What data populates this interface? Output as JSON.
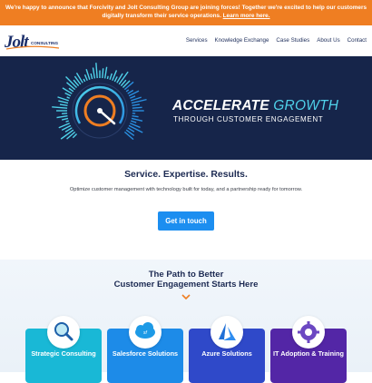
{
  "banner": {
    "text": "We're happy to announce that Forcivity and Jolt Consulting Group are joining forces! Together we're excited to help our customers digitally transform their service operations.",
    "link": "Learn more here."
  },
  "logo": {
    "word": "Jolt",
    "sub": "CONSULTING"
  },
  "nav": [
    "Services",
    "Knowledge Exchange",
    "Case Studies",
    "About Us",
    "Contact"
  ],
  "hero": {
    "headline_bold": "ACCELERATE",
    "headline_light": "GROWTH",
    "subline": "THROUGH CUSTOMER ENGAGEMENT"
  },
  "services": {
    "title": "Service. Expertise. Results.",
    "subtitle": "Optimize customer management with technology built for today, and a partnership ready for tomorrow.",
    "cta": "Get in touch"
  },
  "path": {
    "title_line1": "The Path to Better",
    "title_line2": "Customer Engagement Starts Here",
    "cards": [
      {
        "label": "Strategic Consulting",
        "color": "#19b8d6",
        "icon": "magnifier-icon"
      },
      {
        "label": "Salesforce Solutions",
        "color": "#1d8be8",
        "icon": "salesforce-icon"
      },
      {
        "label": "Azure Solutions",
        "color": "#2f49c9",
        "icon": "azure-icon"
      },
      {
        "label": "IT Adoption & Training",
        "color": "#5326a6",
        "icon": "gear-icon"
      }
    ]
  },
  "colors": {
    "banner": "#ef7e22",
    "hero_bg": "#16254a",
    "accent": "#4fd2ea",
    "cta": "#1c8ef0",
    "navy": "#1c2a52"
  }
}
